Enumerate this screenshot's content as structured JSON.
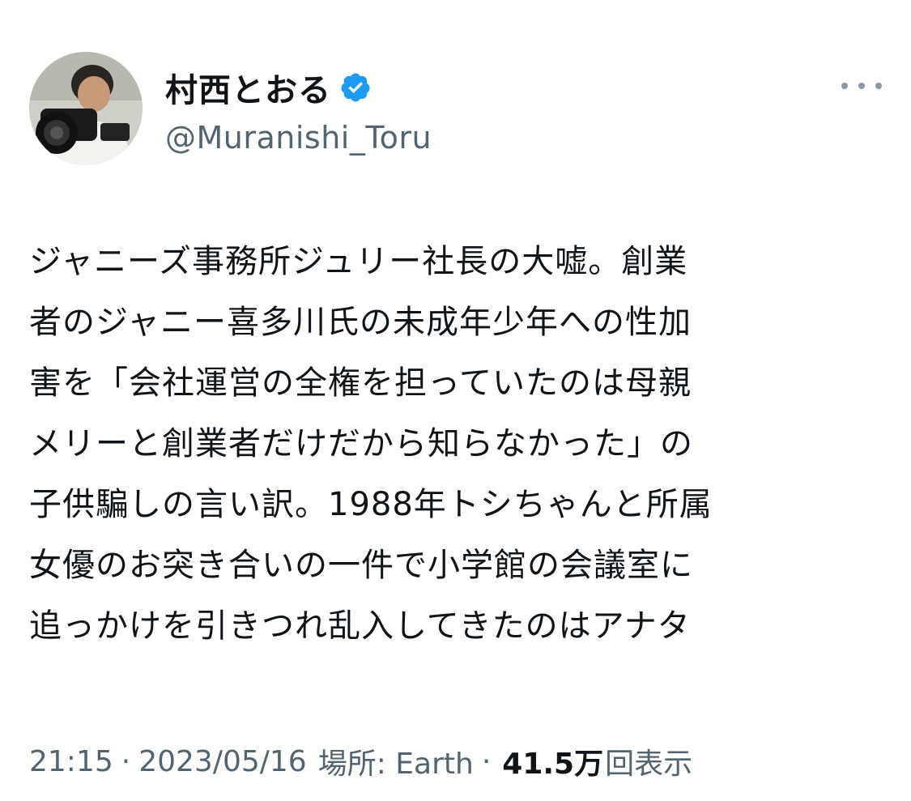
{
  "author": {
    "display_name": "村西とおる",
    "handle": "@Muranishi_Toru",
    "verified": true
  },
  "tweet": {
    "lines": [
      "ジャニーズ事務所ジュリー社長の大嘘。創業",
      "者のジャニー喜多川氏の未成年少年への性加",
      "害を「会社運営の全権を担っていたのは母親",
      "メリーと創業者だけだから知らなかった」の",
      "子供騙しの言い訳。1988年トシちゃんと所属",
      "女優のお突き合いの一件で小学館の会議室に",
      "追っかけを引きつれ乱入してきたのはアナタ"
    ]
  },
  "meta": {
    "time": "21:15",
    "date": "2023/05/16",
    "separator": "·",
    "location_label": "場所: Earth",
    "views_count": "41.5万",
    "views_label": "回表示"
  },
  "icons": {
    "verified": "verified-badge-icon",
    "more": "more-options-icon"
  },
  "colors": {
    "verified_blue": "#1d9bf0",
    "secondary_text": "#536471",
    "primary_text": "#0f1419"
  }
}
